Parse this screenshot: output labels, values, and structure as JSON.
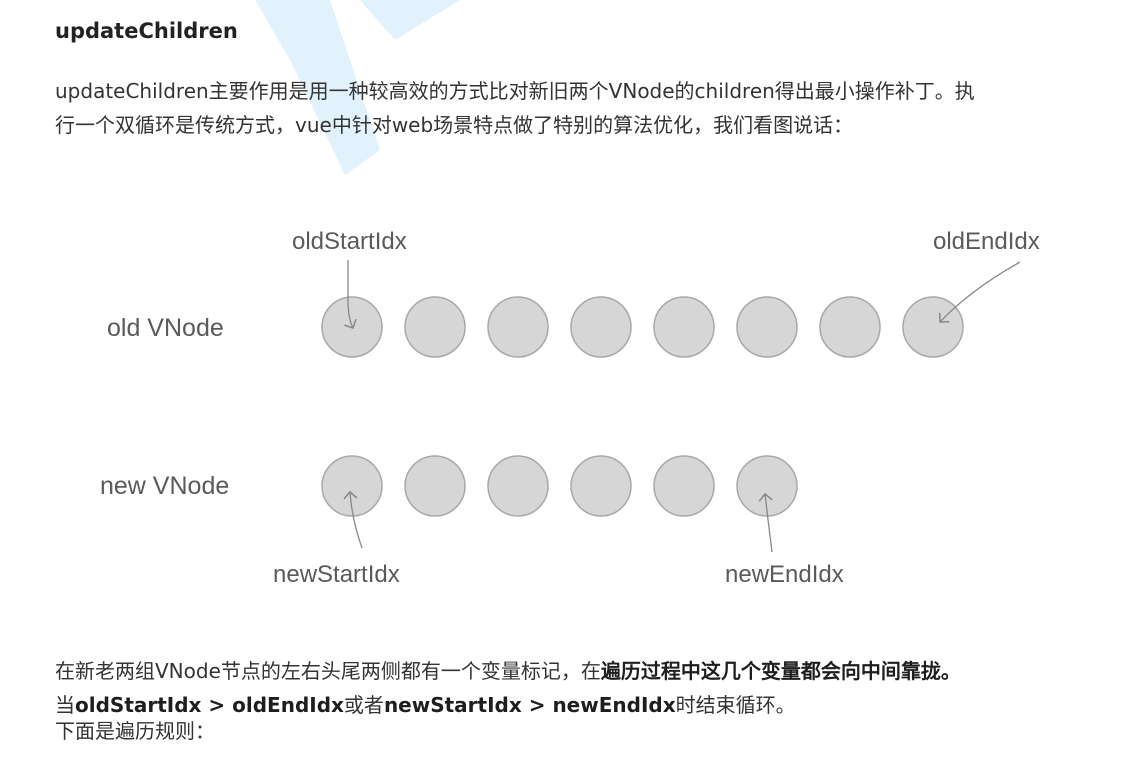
{
  "section": {
    "heading": "updateChildren",
    "intro_line1": "updateChildren主要作用是用一种较高效的方式比对新旧两个VNode的children得出最小操作补丁。执",
    "intro_line2": "行一个双循环是传统方式，vue中针对web场景特点做了特别的算法优化，我们看图说话："
  },
  "diagram": {
    "old_row_label": "old VNode",
    "new_row_label": "new VNode",
    "old_node_count": 8,
    "new_node_count": 6,
    "pointers": {
      "old_start": "oldStartIdx",
      "old_end": "oldEndIdx",
      "new_start": "newStartIdx",
      "new_end": "newEndIdx"
    },
    "node_fill": "#d6d6d6",
    "node_stroke": "#a8a8a8"
  },
  "explanation": {
    "line1_text": "在新老两组VNode节点的左右头尾两侧都有一个变量标记，在",
    "line1_bold": "遍历过程中这几个变量都会向中间靠拢。",
    "line2_pre": "当",
    "line2_bold1": "oldStartIdx > oldEndIdx",
    "line2_mid": "或者",
    "line2_bold2": "newStartIdx > newEndIdx",
    "line2_post": "时结束循环。"
  },
  "rules_heading": "下面是遍历规则：",
  "watermark_color": "#c9e8fb"
}
